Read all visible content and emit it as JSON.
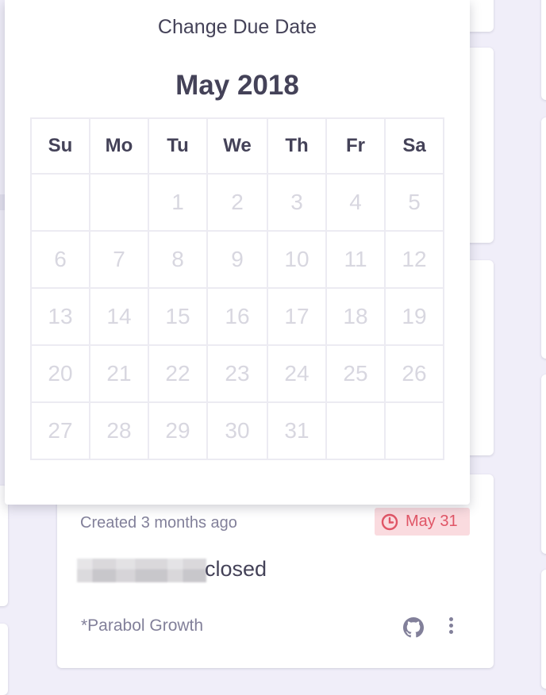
{
  "popup": {
    "title": "Change Due Date",
    "month_label": "May 2018",
    "weekdays": [
      "Su",
      "Mo",
      "Tu",
      "We",
      "Th",
      "Fr",
      "Sa"
    ],
    "weeks": [
      [
        "",
        "",
        "1",
        "2",
        "3",
        "4",
        "5"
      ],
      [
        "6",
        "7",
        "8",
        "9",
        "10",
        "11",
        "12"
      ],
      [
        "13",
        "14",
        "15",
        "16",
        "17",
        "18",
        "19"
      ],
      [
        "20",
        "21",
        "22",
        "23",
        "24",
        "25",
        "26"
      ],
      [
        "27",
        "28",
        "29",
        "30",
        "31",
        "",
        ""
      ]
    ]
  },
  "task_card": {
    "created": "Created 3 months ago",
    "due_date": "May 31",
    "text_suffix": "closed",
    "project": "*Parabol Growth",
    "icons": [
      "clock-icon",
      "github-icon",
      "more-vertical-icon"
    ]
  },
  "colors": {
    "background": "#f0eef9",
    "text": "#444258",
    "muted_text": "#82809a",
    "overdue_badge_bg": "#fadbdf",
    "overdue_badge_text": "#e05566",
    "disabled_day": "#d8d7e0"
  }
}
